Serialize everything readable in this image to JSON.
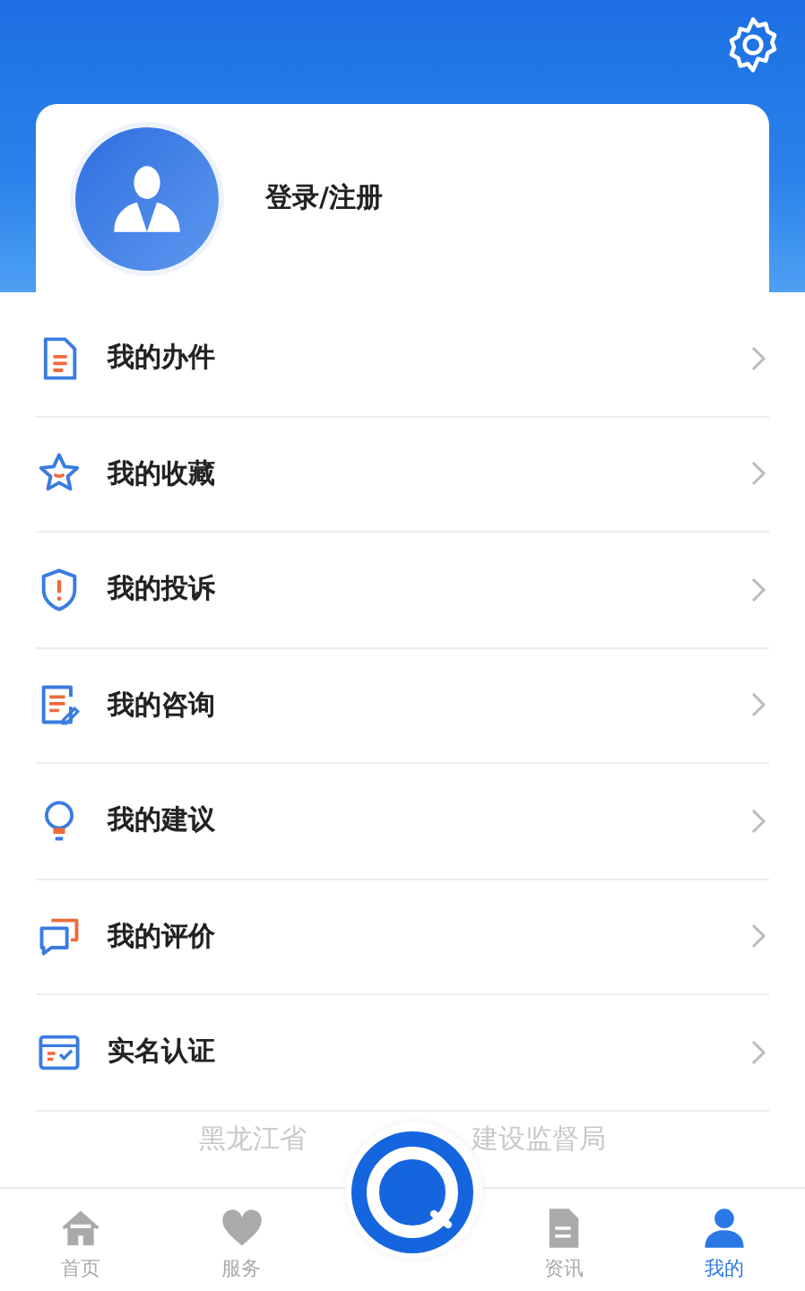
{
  "header": {
    "login_label": "登录/注册"
  },
  "menu": [
    {
      "label": "我的办件"
    },
    {
      "label": "我的收藏"
    },
    {
      "label": "我的投诉"
    },
    {
      "label": "我的咨询"
    },
    {
      "label": "我的建议"
    },
    {
      "label": "我的评价"
    },
    {
      "label": "实名认证"
    }
  ],
  "footer": {
    "text_left": "黑龙江省",
    "text_right": "建设监督局"
  },
  "tab_bar": [
    {
      "label": "首页",
      "selected": false
    },
    {
      "label": "服务",
      "selected": false
    },
    {
      "label": "资讯",
      "selected": false
    },
    {
      "label": "我的",
      "selected": true
    }
  ]
}
